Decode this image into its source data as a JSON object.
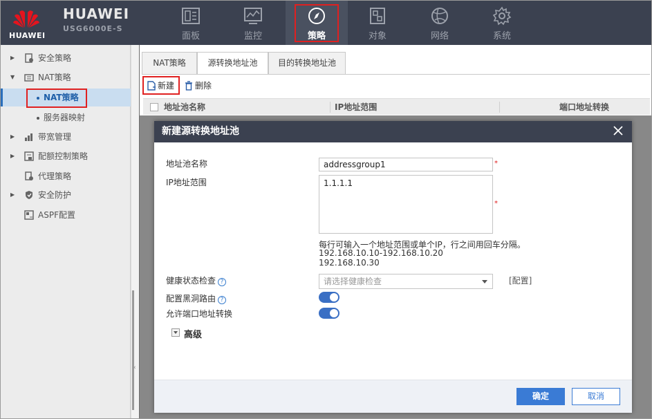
{
  "header": {
    "logo_text": "HUAWEI",
    "brand_title": "HUAWEI",
    "brand_model": "USG6000E-S",
    "nav": [
      {
        "label": "面板",
        "icon": "dashboard-icon"
      },
      {
        "label": "监控",
        "icon": "monitor-icon"
      },
      {
        "label": "策略",
        "icon": "compass-icon",
        "active": true
      },
      {
        "label": "对象",
        "icon": "object-icon"
      },
      {
        "label": "网络",
        "icon": "globe-icon"
      },
      {
        "label": "系统",
        "icon": "gear-icon"
      }
    ]
  },
  "sidebar": {
    "items": [
      {
        "label": "安全策略",
        "icon": "security-policy-icon",
        "expandable": true
      },
      {
        "label": "NAT策略",
        "icon": "nat-icon",
        "expanded": true
      },
      {
        "label": "NAT策略",
        "child": true,
        "selected": true
      },
      {
        "label": "服务器映射",
        "child": true
      },
      {
        "label": "带宽管理",
        "icon": "bandwidth-icon",
        "expandable": true
      },
      {
        "label": "配额控制策略",
        "icon": "quota-icon",
        "expandable": true
      },
      {
        "label": "代理策略",
        "icon": "proxy-icon"
      },
      {
        "label": "安全防护",
        "icon": "shield-icon",
        "expandable": true
      },
      {
        "label": "ASPF配置",
        "icon": "aspf-icon"
      }
    ]
  },
  "main": {
    "tabs": [
      "NAT策略",
      "源转换地址池",
      "目的转换地址池"
    ],
    "active_tab": "源转换地址池",
    "toolbar": {
      "new_label": "新建",
      "delete_label": "删除"
    },
    "columns": [
      "地址池名称",
      "IP地址范围",
      "端口地址转换"
    ]
  },
  "dialog": {
    "title": "新建源转换地址池",
    "fields": {
      "pool_name_label": "地址池名称",
      "pool_name_value": "addressgroup1",
      "ip_range_label": "IP地址范围",
      "ip_range_value": "1.1.1.1",
      "ip_hint_1": "每行可输入一个地址范围或单个IP，行之间用回车分隔。",
      "ip_hint_2": "192.168.10.10-192.168.10.20",
      "ip_hint_3": "192.168.10.30",
      "health_label": "健康状态检查",
      "health_placeholder": "请选择健康检查",
      "config_link": "[配置]",
      "blackhole_label": "配置黑洞路由",
      "blackhole_on": true,
      "pat_label": "允许端口地址转换",
      "pat_on": true,
      "advanced_label": "高级"
    },
    "ok_label": "确定",
    "cancel_label": "取消"
  },
  "colors": {
    "header_bg": "#3b4150",
    "accent": "#3a7bd5",
    "highlight_red": "#e02020"
  }
}
